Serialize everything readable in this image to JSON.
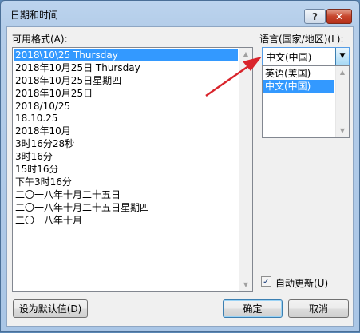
{
  "window": {
    "title": "日期和时间",
    "help": "?",
    "close": "✕"
  },
  "formats": {
    "label": "可用格式(A):",
    "items": [
      "2018\\10\\25 Thursday",
      "2018年10月25日 Thursday",
      "2018年10月25日星期四",
      "2018年10月25日",
      "2018/10/25",
      "18.10.25",
      "2018年10月",
      "3时16分28秒",
      "3时16分",
      "15时16分",
      "下午3时16分",
      "二〇一八年十月二十五日",
      "二〇一八年十月二十五日星期四",
      "二〇一八年十月"
    ],
    "selected_index": 0
  },
  "language": {
    "label": "语言(国家/地区)(L):",
    "value": "中文(中国)",
    "options": [
      "英语(美国)",
      "中文(中国)"
    ],
    "selected_index": 1
  },
  "auto_update": {
    "label": "自动更新(U)",
    "checked": true,
    "check_mark": "✓"
  },
  "buttons": {
    "set_default": "设为默认值(D)",
    "ok": "确定",
    "cancel": "取消"
  },
  "colors": {
    "selection": "#3399ff",
    "annotation_arrow": "#d9242b"
  }
}
